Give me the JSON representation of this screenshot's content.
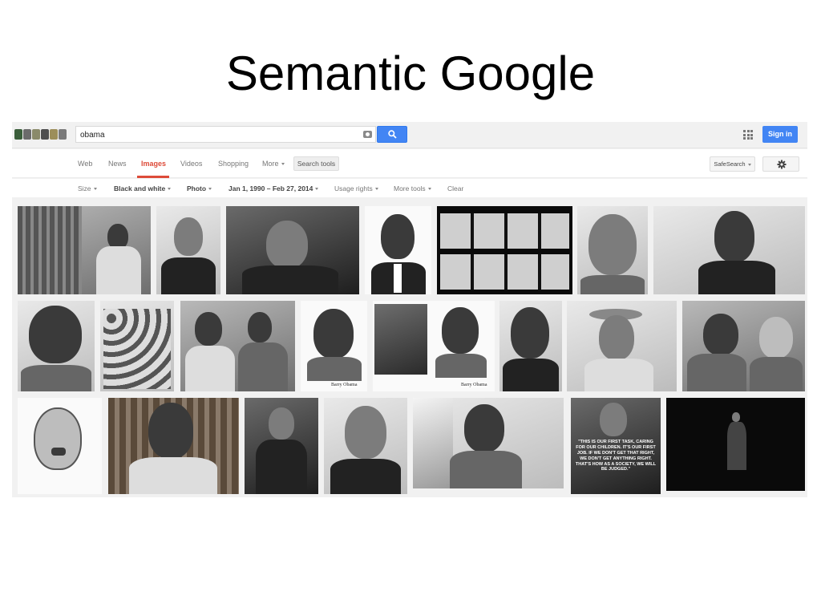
{
  "slide": {
    "title": "Semantic Google"
  },
  "header": {
    "search_value": "obama",
    "signin_label": "Sign in"
  },
  "tabs": [
    {
      "label": "Web",
      "active": false
    },
    {
      "label": "News",
      "active": false
    },
    {
      "label": "Images",
      "active": true
    },
    {
      "label": "Videos",
      "active": false
    },
    {
      "label": "Shopping",
      "active": false
    },
    {
      "label": "More",
      "active": false
    }
  ],
  "search_tools_label": "Search tools",
  "safesearch_label": "SafeSearch",
  "filters": [
    {
      "label": "Size",
      "bold": false
    },
    {
      "label": "Black and white",
      "bold": true
    },
    {
      "label": "Photo",
      "bold": true
    },
    {
      "label": "Jan 1, 1990 – Feb 27, 2014",
      "bold": true
    },
    {
      "label": "Usage rights",
      "bold": false
    },
    {
      "label": "More tools",
      "bold": false
    },
    {
      "label": "Clear",
      "bold": false
    }
  ],
  "image_captions": {
    "yearbook_1": "Barry Obama",
    "yearbook_2": "Barry Obama",
    "quote": "\"THIS IS OUR FIRST TASK, CARING FOR OUR CHILDREN. IT'S OUR FIRST JOB. IF WE DON'T GET THAT RIGHT, WE DON'T GET ANYTHING RIGHT. THAT'S HOW AS A SOCIETY, WE WILL BE JUDGED.\""
  },
  "colors": {
    "accent_red": "#dd4b39",
    "button_blue": "#4285f4"
  }
}
